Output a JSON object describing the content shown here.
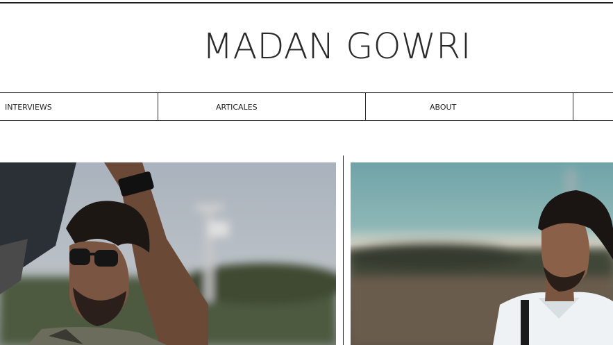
{
  "header": {
    "title": "MADAN GOWRI"
  },
  "nav": {
    "items": [
      {
        "label": "INTERVIEWS"
      },
      {
        "label": "ARTICALES"
      },
      {
        "label": "ABOUT"
      }
    ]
  },
  "gallery": {
    "photos": [
      {
        "name": "photo-man-sunglasses"
      },
      {
        "name": "photo-man-white-shirt"
      }
    ]
  },
  "colors": {
    "text": "#2a2a2a",
    "rule": "#1c1c1c",
    "background": "#ffffff"
  }
}
